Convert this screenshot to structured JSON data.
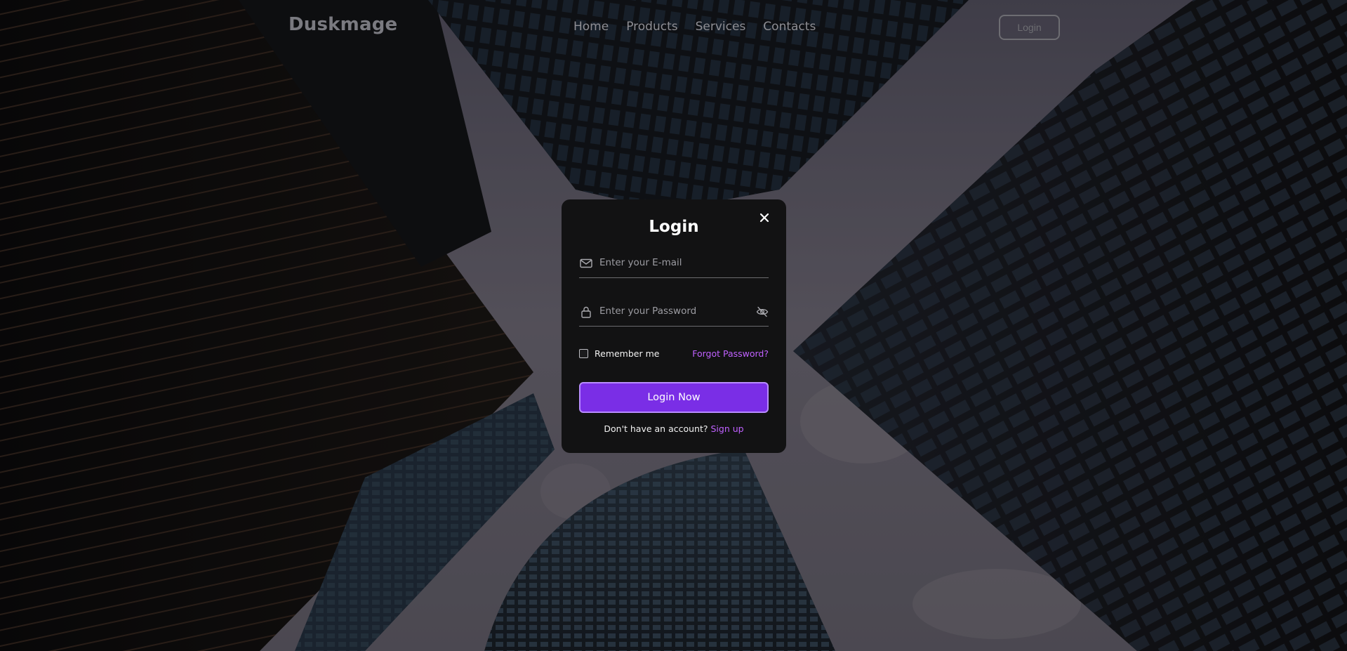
{
  "header": {
    "logo": "Duskmage",
    "nav": [
      "Home",
      "Products",
      "Services",
      "Contacts"
    ],
    "login_button": "Login"
  },
  "modal": {
    "title": "Login",
    "email_placeholder": "Enter your E-mail",
    "password_placeholder": "Enter your Password",
    "remember_label": "Remember me",
    "forgot_link": "Forgot Password?",
    "submit_label": "Login Now",
    "no_account_text": "Don't have an account?",
    "signup_link": "Sign up"
  },
  "colors": {
    "accent": "#7a2ee6",
    "link": "#c061ff",
    "modal_bg": "#121213"
  },
  "icons": [
    "close-icon",
    "mail-icon",
    "lock-icon",
    "eye-off-icon"
  ]
}
